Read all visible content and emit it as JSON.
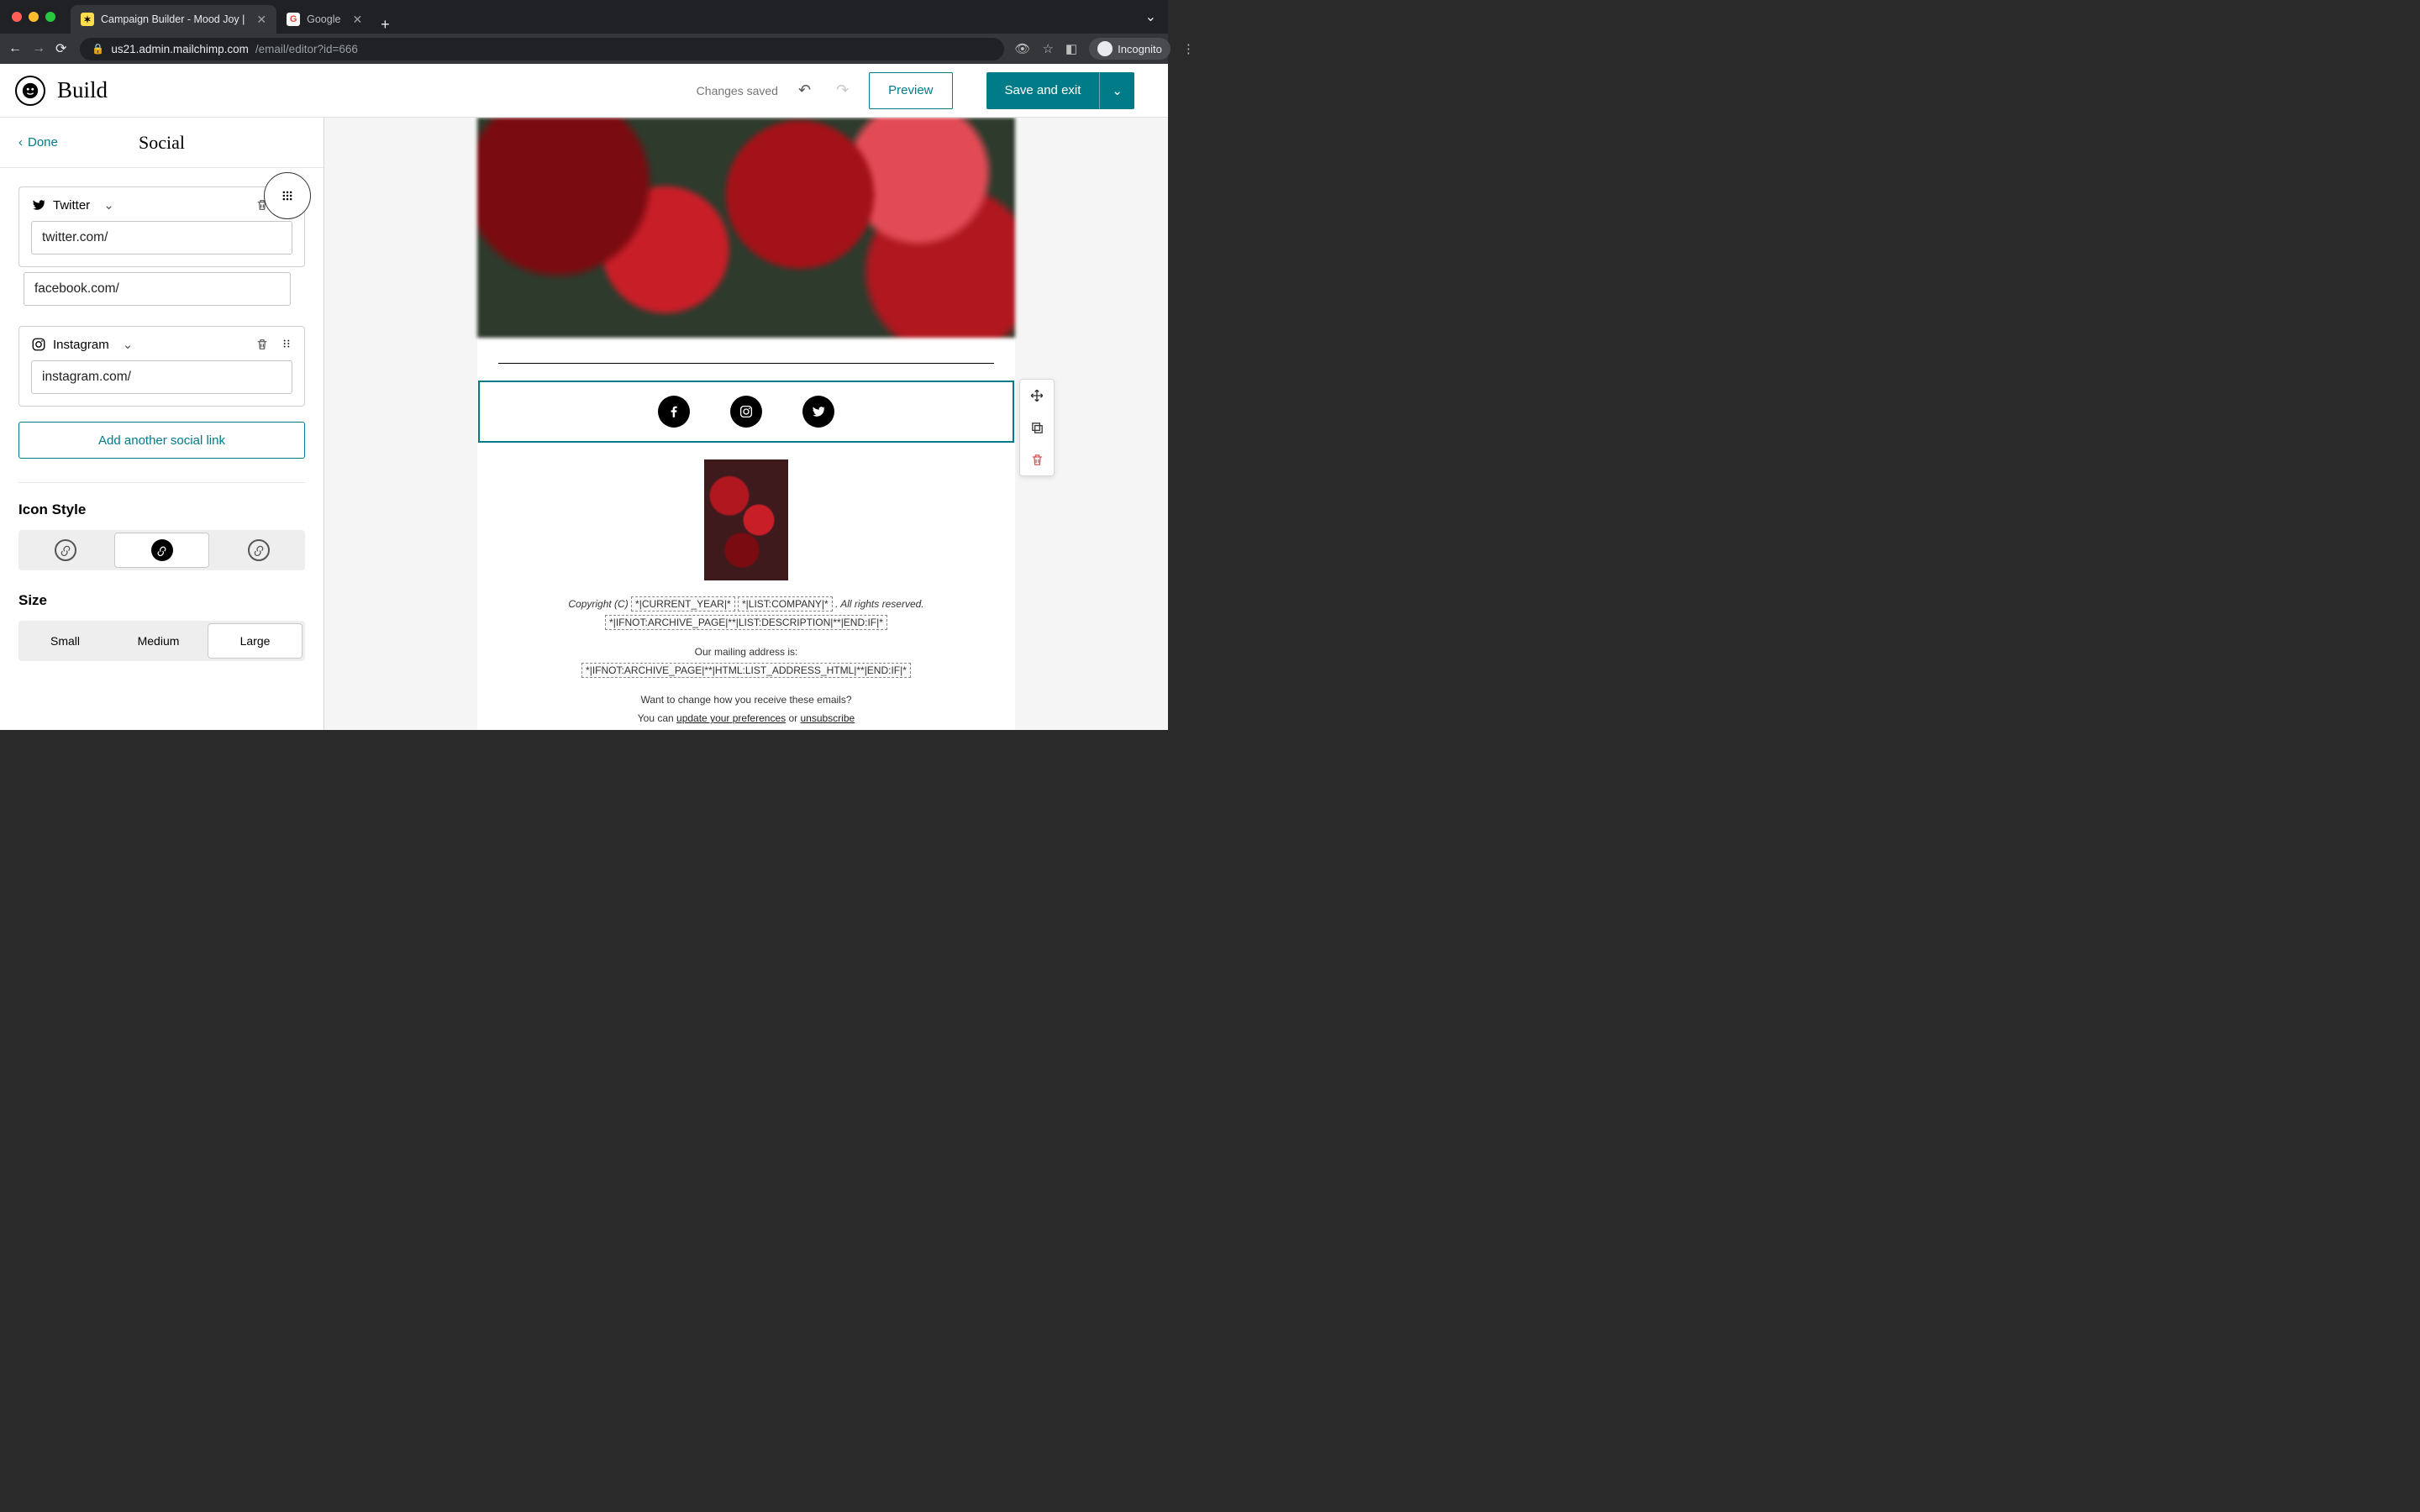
{
  "browser": {
    "tabs": [
      {
        "title": "Campaign Builder - Mood Joy |",
        "active": true
      },
      {
        "title": "Google",
        "active": false
      }
    ],
    "url_host": "us21.admin.mailchimp.com",
    "url_path": "/email/editor?id=666",
    "profile_label": "Incognito"
  },
  "header": {
    "title": "Build",
    "status": "Changes saved",
    "preview_label": "Preview",
    "save_label": "Save and exit"
  },
  "panel": {
    "done_label": "Done",
    "title": "Social",
    "cards": [
      {
        "platform": "Twitter",
        "url": "twitter.com/"
      },
      {
        "platform_hidden": "Facebook",
        "url": "facebook.com/"
      },
      {
        "platform": "Instagram",
        "url": "instagram.com/"
      }
    ],
    "add_label": "Add another social link",
    "icon_style": {
      "label": "Icon Style",
      "selected_index": 1
    },
    "size": {
      "label": "Size",
      "options": [
        "Small",
        "Medium",
        "Large"
      ],
      "selected_index": 2
    }
  },
  "canvas": {
    "social_icons": [
      "facebook",
      "instagram",
      "twitter"
    ],
    "footer": {
      "copyright_prefix": "Copyright (C) ",
      "merge_year": "*|CURRENT_YEAR|*",
      "merge_company": "*|LIST:COMPANY|*",
      "copyright_suffix": ". All rights reserved.",
      "merge_archive_desc": "*|IFNOT:ARCHIVE_PAGE|**|LIST:DESCRIPTION|**|END:IF|*",
      "mailing_label": "Our mailing address is:",
      "merge_archive_addr": "*|IFNOT:ARCHIVE_PAGE|**|HTML:LIST_ADDRESS_HTML|**|END:IF|*",
      "change_q": "Want to change how you receive these emails?",
      "you_can": "You can ",
      "update_pref": "update your preferences",
      "or": " or ",
      "unsub": "unsubscribe"
    }
  }
}
